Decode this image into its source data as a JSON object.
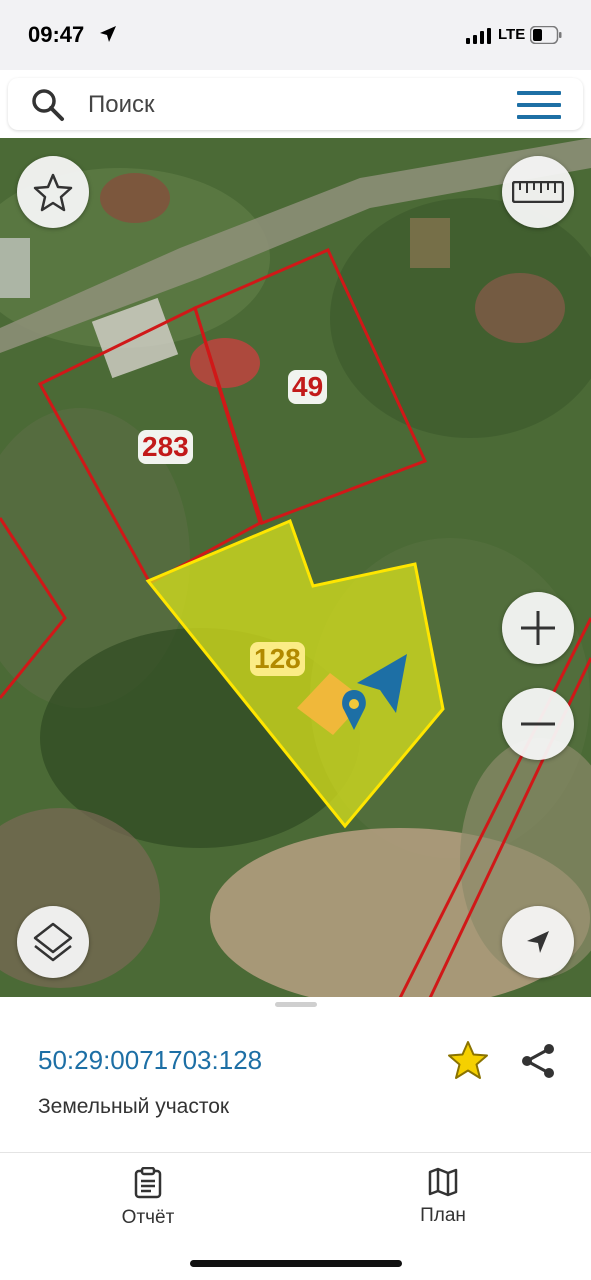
{
  "status_bar": {
    "time": "09:47",
    "network": "LTE"
  },
  "search": {
    "placeholder": "Поиск",
    "icon": "search-icon",
    "menu_icon": "hamburger-menu-icon"
  },
  "map": {
    "parcels": [
      {
        "label": "283",
        "color": "#c21a1a"
      },
      {
        "label": "49",
        "color": "#c21a1a"
      },
      {
        "label": "128",
        "color": "#f2e31a",
        "selected": true
      }
    ],
    "buttons": {
      "favorite": "star-icon",
      "ruler": "ruler-icon",
      "zoom_in": "plus-icon",
      "zoom_out": "minus-icon",
      "layers": "layers-icon",
      "my_location": "navigation-arrow-icon"
    }
  },
  "sheet": {
    "cadastral_number": "50:29:0071703:128",
    "object_type": "Земельный участок",
    "accent_color": "#1d6fa5",
    "star_color": "#d4b000"
  },
  "tabbar": {
    "tabs": [
      {
        "label": "Отчёт",
        "icon": "report-clipboard-icon"
      },
      {
        "label": "План",
        "icon": "map-plan-icon"
      }
    ]
  }
}
